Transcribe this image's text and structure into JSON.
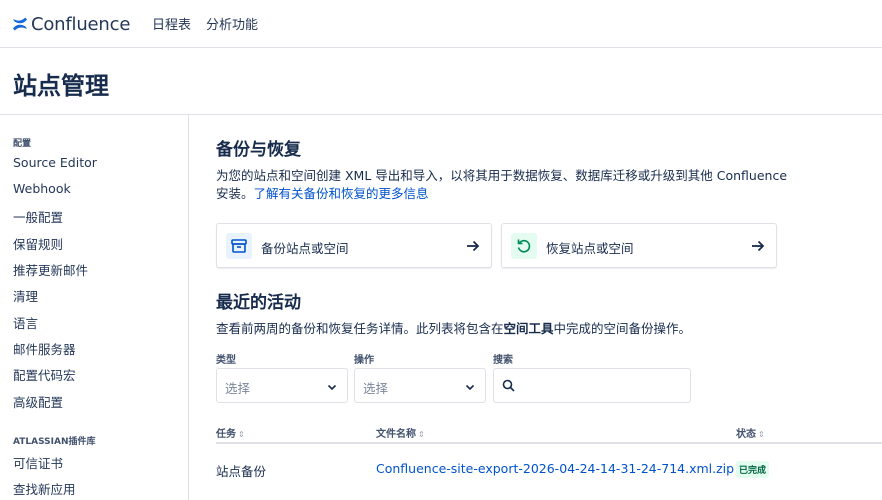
{
  "topnav": {
    "brand": "Confluence",
    "items": [
      {
        "label": "日程表"
      },
      {
        "label": "分析功能"
      }
    ]
  },
  "page": {
    "title": "站点管理"
  },
  "sidebar": {
    "section1": {
      "heading": "配置",
      "items": [
        "Source Editor",
        "Webhook",
        "一般配置",
        "保留规则",
        "推荐更新邮件",
        "清理",
        "语言",
        "邮件服务器",
        "配置代码宏",
        "高级配置"
      ]
    },
    "section2": {
      "heading": "ATLASSIAN插件库",
      "items": [
        "可信证书",
        "查找新应用"
      ]
    }
  },
  "backup": {
    "title": "备份与恢复",
    "desc_line1": "为您的站点和空间创建 XML 导出和导入，以将其用于数据恢复、数据库迁移或升级到其他 Confluence",
    "desc_line2_prefix": "安装。",
    "desc_link": "了解有关备份和恢复的更多信息",
    "cards": [
      {
        "label": "备份站点或空间",
        "icon": "archive-icon",
        "icon_bg": "#E9F2FF",
        "icon_color": "#0052CC"
      },
      {
        "label": "恢复站点或空间",
        "icon": "restore-icon",
        "icon_bg": "#E3FCEF",
        "icon_color": "#00875A"
      }
    ]
  },
  "activity": {
    "title": "最近的活动",
    "desc_prefix": "查看前两周的备份和恢复任务详情。此列表将包含在",
    "desc_bold": "空间工具",
    "desc_suffix": "中完成的空间备份操作。",
    "filters": {
      "type_label": "类型",
      "type_value": "选择",
      "action_label": "操作",
      "action_value": "选择",
      "search_label": "搜索",
      "search_value": ""
    },
    "columns": {
      "task": "任务",
      "filename": "文件名称",
      "status": "状态"
    },
    "rows": [
      {
        "task": "站点备份",
        "filename": "Confluence-site-export-2026-04-24-14-31-24-714.xml.zip",
        "status": "已完成",
        "status_color": "#006644"
      }
    ]
  }
}
